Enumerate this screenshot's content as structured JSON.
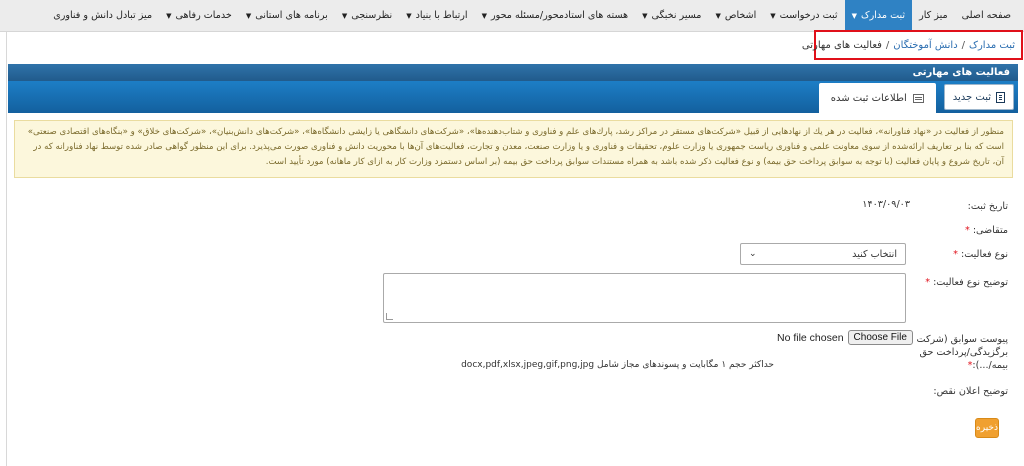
{
  "nav": {
    "items": [
      {
        "label": "صفحه اصلی",
        "caret": false,
        "active": false
      },
      {
        "label": "میز کار",
        "caret": false,
        "active": false
      },
      {
        "label": "ثبت مدارک",
        "caret": true,
        "active": true
      },
      {
        "label": "ثبت درخواست",
        "caret": true,
        "active": false
      },
      {
        "label": "اشخاص",
        "caret": true,
        "active": false
      },
      {
        "label": "مسیر نخبگی",
        "caret": true,
        "active": false
      },
      {
        "label": "هسته های استادمحور/مسئله محور",
        "caret": true,
        "active": false
      },
      {
        "label": "ارتباط با بنیاد",
        "caret": true,
        "active": false
      },
      {
        "label": "نظرسنجی",
        "caret": true,
        "active": false
      },
      {
        "label": "برنامه های استانی",
        "caret": true,
        "active": false
      },
      {
        "label": "خدمات رفاهی",
        "caret": true,
        "active": false
      },
      {
        "label": "میز تبادل دانش و فناوری",
        "caret": false,
        "active": false
      }
    ]
  },
  "breadcrumb": {
    "item1": "ثبت مدارک",
    "item2": "دانش آموختگان",
    "current": "فعالیت های مهارتی",
    "separator": "/"
  },
  "panel": {
    "title": "فعالیت های مهارتی",
    "new_button": "ثبت جدید",
    "info_tab": "اطلاعات ثبت شده"
  },
  "alert": {
    "text": "منظور از فعالیت در «نهاد فناورانه»، فعالیت در هر یك از نهادهایی از قبیل «شرکت‌های مستقر در مراکز رشد، پارك‌های علم و فناوری و شتاب‌دهنده‌ها»، «شرکت‌های دانشگاهی یا زایشی دانشگاه‌ها»، «شرکت‌های دانش‌بنیان»، «شرکت‌های خلاق» و «بنگاه‌های اقتصادی صنعتی» است که بنا بر تعاریف ارائه‌شده از سوی معاونت علمی و فناوری ریاست جمهوری یا وزارت علوم، تحقیقات و فناوری و یا وزارت صنعت، معدن و تجارت، فعالیت‌های آن‌ها با محوریت دانش و فناوری صورت می‌پذیرد. برای این منظور گواهی صادر شده توسط نهاد فناورانه که در آن، تاریخ شروع و پایان فعالیت (با توجه به سوابق پرداخت حق بیمه) و نوع فعالیت ذکر شده باشد به همراه مستندات سوابق پرداخت حق بیمه (بر اساس دستمزد وزارت کار به ازای کار ماهانه) مورد تأیید است."
  },
  "form": {
    "date_label": "تاریخ ثبت:",
    "date_value": "۱۴۰۳/۰۹/۰۳",
    "applicant_label": "متقاضی:",
    "activity_type_label": "نوع فعالیت:",
    "activity_type_value": "انتخاب کنید",
    "activity_desc_label": "توضیح نوع فعالیت:",
    "attach_label_line1": "پیوست سوابق (شرکت در.../",
    "attach_label_line2": "برگزیدگی/پرداخت حق",
    "attach_label_line3": "بیمه/...):",
    "file_button": "Choose File",
    "file_status": "No file chosen",
    "hint": "حداکثر حجم ۱ مگابایت و پسوندهای مجاز شامل docx,pdf,xlsx,jpeg,gif,png,jpg",
    "deficiency_label": "توضیح اعلان نقص:",
    "save_button": "ذخیره"
  }
}
